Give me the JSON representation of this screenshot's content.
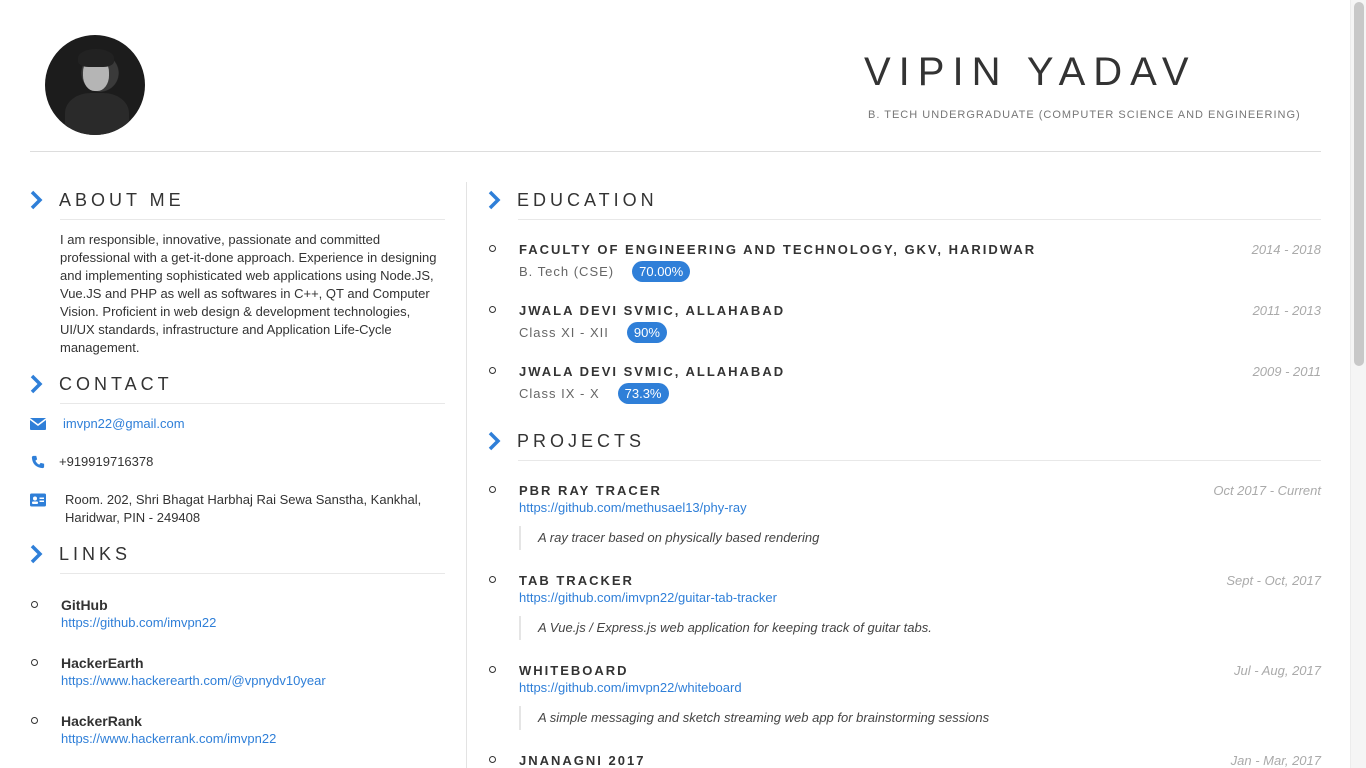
{
  "header": {
    "name": "VIPIN YADAV",
    "subtitle": "B. TECH UNDERGRADUATE (COMPUTER SCIENCE AND ENGINEERING)"
  },
  "about": {
    "title": "ABOUT ME",
    "text": "I am responsible, innovative, passionate and committed professional with a get-it-done approach. Experience in designing and implementing sophisticated web applications using Node.JS, Vue.JS and PHP as well as softwares in C++, QT and Computer Vision. Proficient in web design & development technologies, UI/UX standards, infrastructure and Application Life-Cycle management."
  },
  "contact": {
    "title": "CONTACT",
    "email": "imvpn22@gmail.com",
    "phone": "+919919716378",
    "address": "Room. 202, Shri Bhagat Harbhaj Rai Sewa Sanstha, Kankhal, Haridwar, PIN - 249408"
  },
  "links": {
    "title": "LINKS",
    "items": [
      {
        "name": "GitHub",
        "url": "https://github.com/imvpn22"
      },
      {
        "name": "HackerEarth",
        "url": "https://www.hackerearth.com/@vpnydv10year"
      },
      {
        "name": "HackerRank",
        "url": "https://www.hackerrank.com/imvpn22"
      }
    ]
  },
  "education": {
    "title": "EDUCATION",
    "items": [
      {
        "school": "FACULTY OF ENGINEERING AND TECHNOLOGY, GKV, HARIDWAR",
        "degree": "B. Tech (CSE)",
        "score": "70.00%",
        "date": "2014 - 2018"
      },
      {
        "school": "JWALA DEVI SVMIC, ALLAHABAD",
        "degree": "Class XI - XII",
        "score": "90%",
        "date": "2011 - 2013"
      },
      {
        "school": "JWALA DEVI SVMIC, ALLAHABAD",
        "degree": "Class IX - X",
        "score": "73.3%",
        "date": "2009 - 2011"
      }
    ]
  },
  "projects": {
    "title": "PROJECTS",
    "items": [
      {
        "name": "PBR RAY TRACER",
        "url": "https://github.com/methusael13/phy-ray",
        "desc": "A ray tracer based on physically based rendering",
        "date": "Oct 2017 - Current"
      },
      {
        "name": "TAB TRACKER",
        "url": "https://github.com/imvpn22/guitar-tab-tracker",
        "desc": "A Vue.js / Express.js web application for keeping track of guitar tabs.",
        "date": "Sept - Oct, 2017"
      },
      {
        "name": "WHITEBOARD",
        "url": "https://github.com/imvpn22/whiteboard",
        "desc": "A simple messaging and sketch streaming web app for brainstorming sessions",
        "date": "Jul - Aug, 2017"
      },
      {
        "name": "JNANAGNI 2017",
        "date": "Jan - Mar, 2017"
      }
    ]
  },
  "colors": {
    "accent": "#2f7fd8",
    "text": "#333333",
    "muted": "#aaaaaa"
  }
}
